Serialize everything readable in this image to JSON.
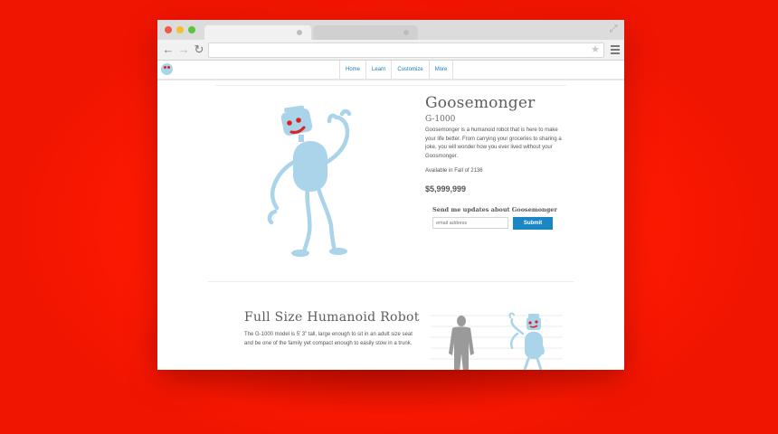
{
  "browser": {
    "icons": {
      "back": "back-arrow-icon",
      "forward": "forward-arrow-icon",
      "reload": "reload-icon",
      "star": "star-icon",
      "menu": "hamburger-menu-icon",
      "expand": "expand-icon"
    }
  },
  "nav": {
    "items": [
      "Home",
      "Learn",
      "Customize",
      "More"
    ]
  },
  "product": {
    "title": "Goosemonger",
    "model": "G-1000",
    "description": "Goosemonger is a humanoid robot that is here to make your life better. From carrying your groceries to sharing a joke, you will wonder how you ever lived without your Goosmonger.",
    "availability": "Available in Fall of 2136",
    "price": "$5,999,999"
  },
  "signup": {
    "label": "Send me updates about Goosemonger",
    "placeholder": "email address",
    "button": "Submit"
  },
  "section": {
    "title": "Full Size Humanoid Robot",
    "text": "The G-1000 model is 5’ 3” tall, large enough to sit in an adult size seat and be one of the family yet compact enough to easily stow in a trunk."
  },
  "colors": {
    "background": "#ff1e00",
    "accent": "#1a86c4",
    "robot": "#a9d4ea",
    "robot_eyes": "#e01f1f",
    "silhouette": "#9a9a9a"
  }
}
